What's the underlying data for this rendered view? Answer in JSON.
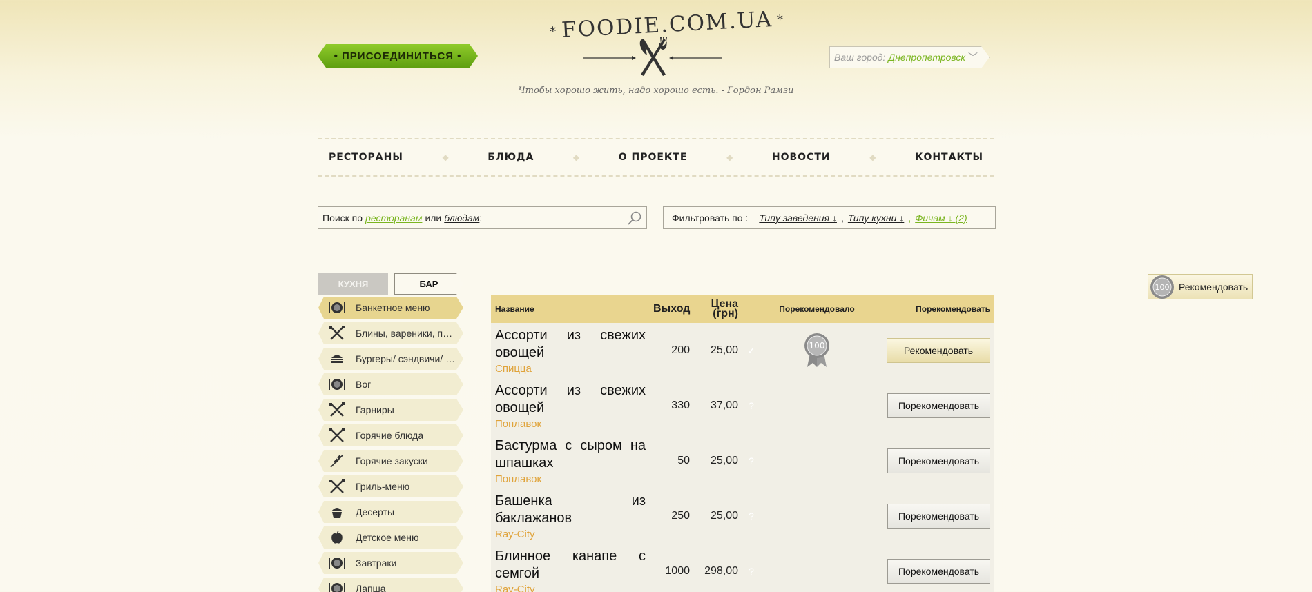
{
  "header": {
    "join_label": "• ПРИСОЕДИНИТЬСЯ •",
    "logo_text": "FOODIE.COM.UA",
    "logo_star": "*",
    "tagline": "Чтобы хорошо жить, надо хорошо есть. - Гордон Рамзи",
    "city_label": "Ваш город:",
    "city_value": "Днепропетровск",
    "city_icon": "chevron-down-icon"
  },
  "nav": {
    "items": [
      "РЕСТОРАНЫ",
      "БЛЮДА",
      "О ПРОЕКТЕ",
      "НОВОСТИ",
      "КОНТАКТЫ"
    ],
    "separator": "◆"
  },
  "search": {
    "prefix": "Поиск по",
    "link_restaurants": "ресторанам",
    "or": "или",
    "link_dishes": "блюдам",
    "suffix": ":",
    "icon": "search-icon"
  },
  "filter": {
    "label": "Фильтровать по :",
    "options": [
      "Типу заведения ↓",
      "Типу кухни ↓",
      "Фичам ↓ (2)"
    ],
    "separator": ","
  },
  "recommend_float": {
    "badge": "100",
    "label": "Рекомендовать"
  },
  "sidebar": {
    "tabs": [
      "КУХНЯ",
      "БАР"
    ],
    "categories": [
      {
        "label": "Банкетное меню",
        "icon": "plate-icon",
        "active": true
      },
      {
        "label": "Блины, вареники, пельмени",
        "icon": "utensils-icon"
      },
      {
        "label": "Бургеры/ сэндвичи/ роллы",
        "icon": "burger-icon"
      },
      {
        "label": "Вог",
        "icon": "plate-icon"
      },
      {
        "label": "Гарниры",
        "icon": "utensils-icon"
      },
      {
        "label": "Горячие блюда",
        "icon": "utensils-icon"
      },
      {
        "label": "Горячие закуски",
        "icon": "skewer-icon"
      },
      {
        "label": "Гриль-меню",
        "icon": "utensils-icon"
      },
      {
        "label": "Десерты",
        "icon": "cupcake-icon"
      },
      {
        "label": "Детское меню",
        "icon": "apple-icon"
      },
      {
        "label": "Завтраки",
        "icon": "plate-icon"
      },
      {
        "label": "Лапша",
        "icon": "plate-icon"
      }
    ]
  },
  "table": {
    "headers": {
      "name": "Название",
      "output": "Выход",
      "price_line1": "Цена",
      "price_line2": "(грн)",
      "recommended_by": "Порекомендовало",
      "recommend": "Порекомендовать"
    },
    "rows": [
      {
        "name": "Ассорти из свежих овощей",
        "restaurant": "Спицца",
        "output": "200",
        "price": "25,00",
        "check": "✓",
        "badge": "100",
        "action": "Рекомендовать",
        "done": true
      },
      {
        "name": "Ассорти из свежих овощей",
        "restaurant": "Поплавок",
        "output": "330",
        "price": "37,00",
        "check": "?",
        "badge": "",
        "action": "Порекомендовать",
        "done": false
      },
      {
        "name": "Бастурма с сыром на шпашках",
        "restaurant": "Поплавок",
        "output": "50",
        "price": "25,00",
        "check": "?",
        "badge": "",
        "action": "Порекомендовать",
        "done": false
      },
      {
        "name": "Башенка из баклажанов",
        "restaurant": "Ray-City",
        "output": "250",
        "price": "25,00",
        "check": "?",
        "badge": "",
        "action": "Порекомендовать",
        "done": false
      },
      {
        "name": "Блинное канапе с семгой",
        "restaurant": "Ray-City",
        "output": "1000",
        "price": "298,00",
        "check": "?",
        "badge": "",
        "action": "Порекомендовать",
        "done": false
      }
    ]
  },
  "colors": {
    "accent_green": "#7ab520",
    "header_yellow": "#e9d58f",
    "restaurant_orange": "#e0a33a"
  }
}
